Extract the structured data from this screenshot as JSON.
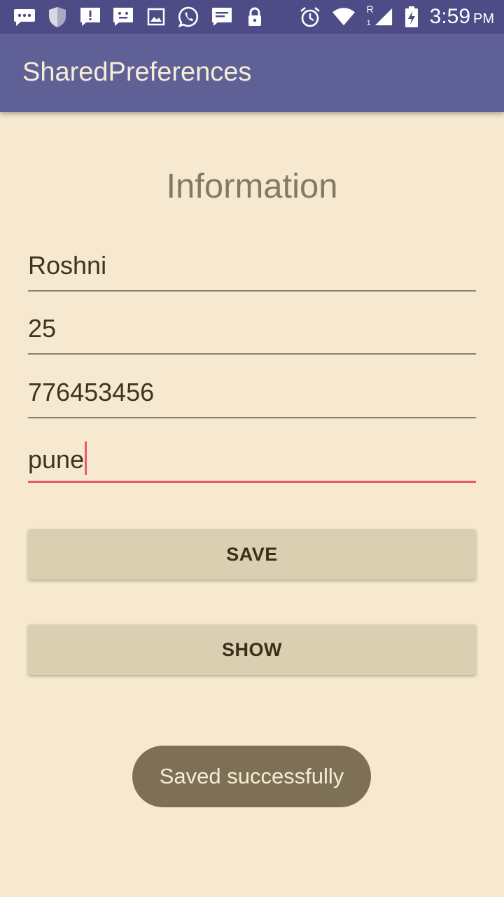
{
  "status_bar": {
    "time": "3:59",
    "ampm": "PM",
    "roaming_label": "R",
    "sim_slot": "1",
    "left_icons": [
      "chat-bubble-icon",
      "shield-icon",
      "alert-message-icon",
      "face-message-icon",
      "image-icon",
      "whatsapp-icon",
      "sms-icon",
      "lock-icon"
    ],
    "right_icons": [
      "alarm-icon",
      "wifi-icon",
      "signal-icon",
      "battery-charging-icon"
    ]
  },
  "app_bar": {
    "title": "SharedPreferences"
  },
  "form": {
    "heading": "Information",
    "fields": [
      {
        "value": "Roshni",
        "focused": false
      },
      {
        "value": "25",
        "focused": false
      },
      {
        "value": "776453456",
        "focused": false
      },
      {
        "value": "pune",
        "focused": true
      }
    ],
    "save_label": "SAVE",
    "show_label": "SHOW"
  },
  "toast": {
    "message": "Saved successfully"
  },
  "colors": {
    "status_bar": "#4d4c87",
    "app_bar": "#5f6196",
    "background": "#f7e9cf",
    "accent": "#e85a6c",
    "button": "#dbcfb2",
    "toast": "#7d7054"
  }
}
